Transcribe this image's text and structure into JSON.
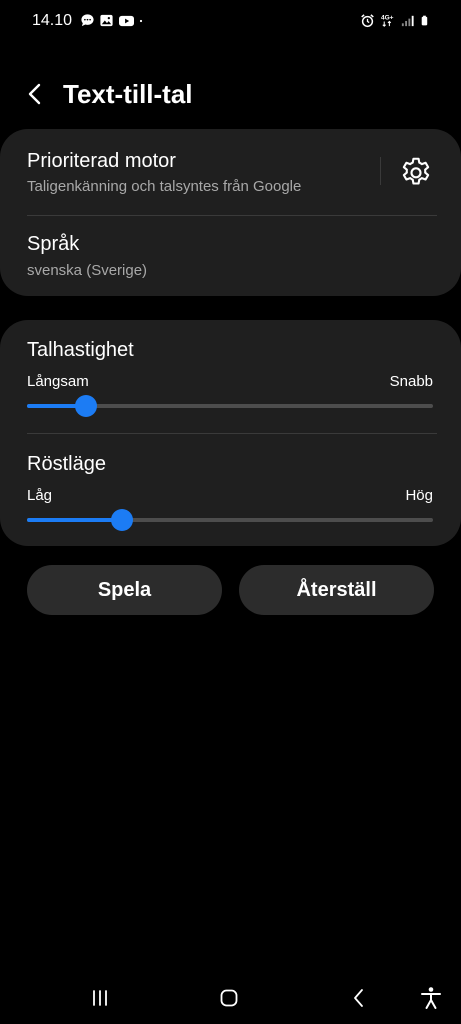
{
  "status_bar": {
    "time": "14.10",
    "notifications": [
      "chat-bubble-icon",
      "image-icon",
      "youtube-icon",
      "dot-icon"
    ],
    "right_icons": [
      "alarm-icon",
      "network-4g-icon",
      "signal-icon",
      "battery-icon"
    ]
  },
  "header": {
    "title": "Text-till-tal",
    "back_icon": "back-arrow-icon"
  },
  "engine_card": {
    "preferred_engine_label": "Prioriterad motor",
    "preferred_engine_value": "Taligenkänning och talsyntes från Google",
    "settings_icon": "gear-icon",
    "language_label": "Språk",
    "language_value": "svenska (Sverige)"
  },
  "speech_rate": {
    "label": "Talhastighet",
    "min_label": "Långsam",
    "max_label": "Snabb",
    "value": 0.145
  },
  "pitch": {
    "label": "Röstläge",
    "min_label": "Låg",
    "max_label": "Hög",
    "value": 0.235
  },
  "actions": {
    "play_label": "Spela",
    "reset_label": "Återställ"
  },
  "navbar": {
    "items": [
      "recents-icon",
      "home-icon",
      "back-icon",
      "accessibility-icon"
    ]
  },
  "colors": {
    "accent": "#1c7cf4",
    "card": "#1f1f1f",
    "button": "#2c2c2c",
    "background": "#000000"
  }
}
